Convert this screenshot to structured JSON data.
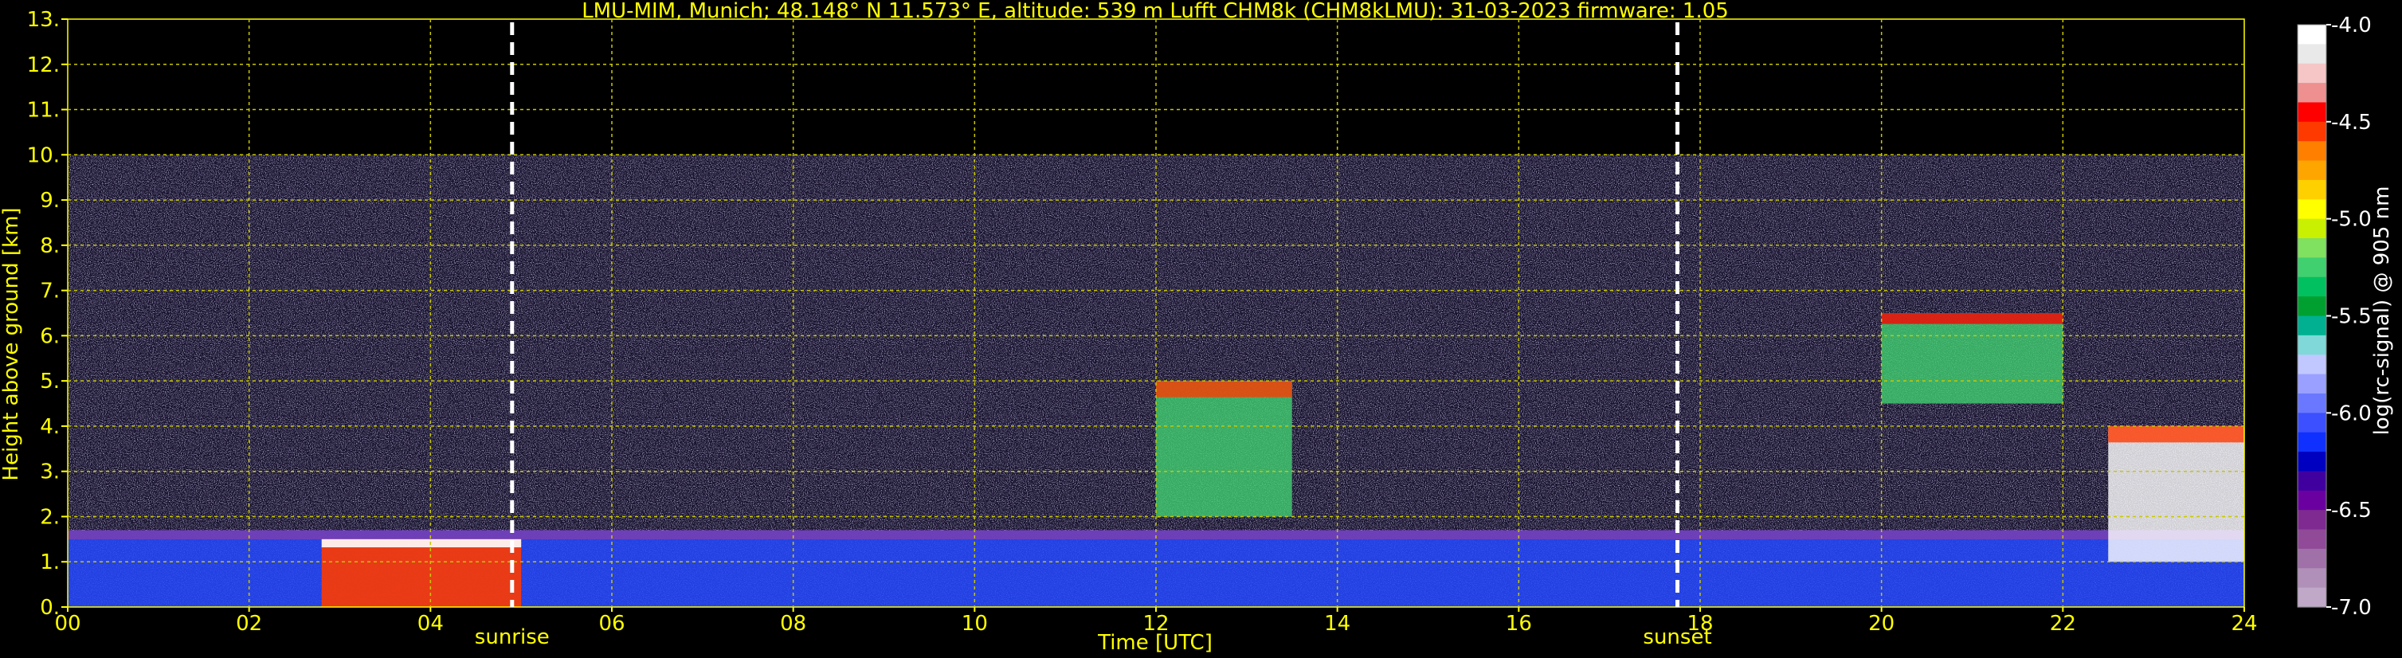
{
  "chart_data": {
    "type": "heatmap",
    "title": "LMU-MIM, Munich; 48.148° N 11.573° E, altitude: 539 m    Lufft CHM8k (CHM8kLMU): 31-03-2023    firmware: 1.05",
    "xlabel": "Time [UTC]",
    "ylabel": "Height above ground [km]",
    "xlim": [
      0,
      24
    ],
    "ylim": [
      0,
      13
    ],
    "x_ticks": [
      "00",
      "02",
      "04",
      "06",
      "08",
      "10",
      "12",
      "14",
      "16",
      "18",
      "20",
      "22",
      "24"
    ],
    "y_ticks": [
      "0.",
      "1.",
      "2.",
      "3.",
      "4.",
      "5.",
      "6.",
      "7.",
      "8.",
      "9.",
      "10.",
      "11.",
      "12.",
      "13."
    ],
    "grid": true,
    "data_top_km": 10,
    "events": [
      {
        "label": "sunrise",
        "time": 4.9
      },
      {
        "label": "sunset",
        "time": 17.75
      }
    ],
    "colorbar": {
      "label": "log(rc-signal) @ 905 nm",
      "range": [
        -7.0,
        -4.0
      ],
      "ticks": [
        "-4.0",
        "-4.5",
        "-5.0",
        "-5.5",
        "-6.0",
        "-6.5",
        "-7.0"
      ],
      "tick_values": [
        -4.0,
        -4.5,
        -5.0,
        -5.5,
        -6.0,
        -6.5,
        -7.0
      ],
      "colors": [
        "#ffffff",
        "#e9e9e9",
        "#f6c6c6",
        "#ee9090",
        "#ff0000",
        "#ff3a00",
        "#ff8000",
        "#ffa500",
        "#ffd000",
        "#ffff00",
        "#c8f000",
        "#80e060",
        "#40d070",
        "#00c060",
        "#00a030",
        "#00b090",
        "#80d8d8",
        "#c0c8ff",
        "#9aa0ff",
        "#6a78ff",
        "#3c50ff",
        "#1030ff",
        "#0000c0",
        "#4000a0",
        "#6a00a0",
        "#7e2a90",
        "#904a98",
        "#a070a8",
        "#b090b8",
        "#c0a8c8"
      ]
    },
    "features": [
      {
        "name": "boundary-layer",
        "t_start": 0.0,
        "t_end": 24.0,
        "top_km": 1.7
      },
      {
        "name": "low-cloud-morning",
        "t_start": 2.8,
        "t_end": 5.0,
        "base_km": 0.0,
        "top_km": 1.5
      },
      {
        "name": "afternoon-cloud",
        "t_start": 12.0,
        "t_end": 13.5,
        "base_km": 2.0,
        "top_km": 5.0
      },
      {
        "name": "evening-cloud",
        "t_start": 20.0,
        "t_end": 22.0,
        "base_km": 4.5,
        "top_km": 6.5
      },
      {
        "name": "late-cloud",
        "t_start": 22.5,
        "t_end": 24.0,
        "base_km": 1.0,
        "top_km": 4.0
      }
    ]
  }
}
